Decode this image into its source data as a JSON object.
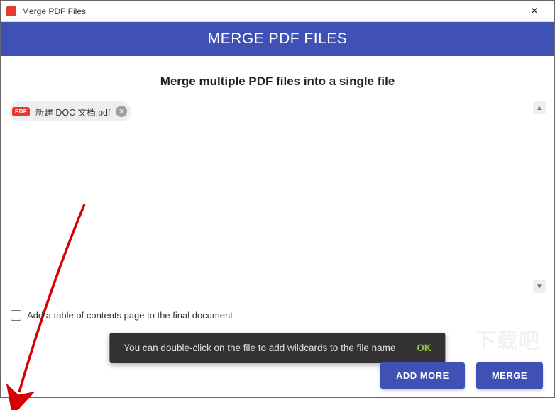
{
  "titlebar": {
    "title": "Merge PDF Files",
    "close_glyph": "✕"
  },
  "banner": {
    "text": "MERGE PDF FILES"
  },
  "subheading": "Merge multiple PDF files into a single file",
  "files": [
    {
      "badge": "PDF",
      "name": "新建 DOC 文档.pdf",
      "remove_glyph": "✕"
    }
  ],
  "scroll": {
    "up_glyph": "▲",
    "down_glyph": "▼"
  },
  "toc": {
    "label": "Add a table of contents page to the final document",
    "checked": false
  },
  "toast": {
    "message": "You can double-click on the file to add wildcards to the file name",
    "ok": "OK"
  },
  "buttons": {
    "add_more": "ADD MORE",
    "merge": "MERGE"
  },
  "watermark": "下载吧"
}
